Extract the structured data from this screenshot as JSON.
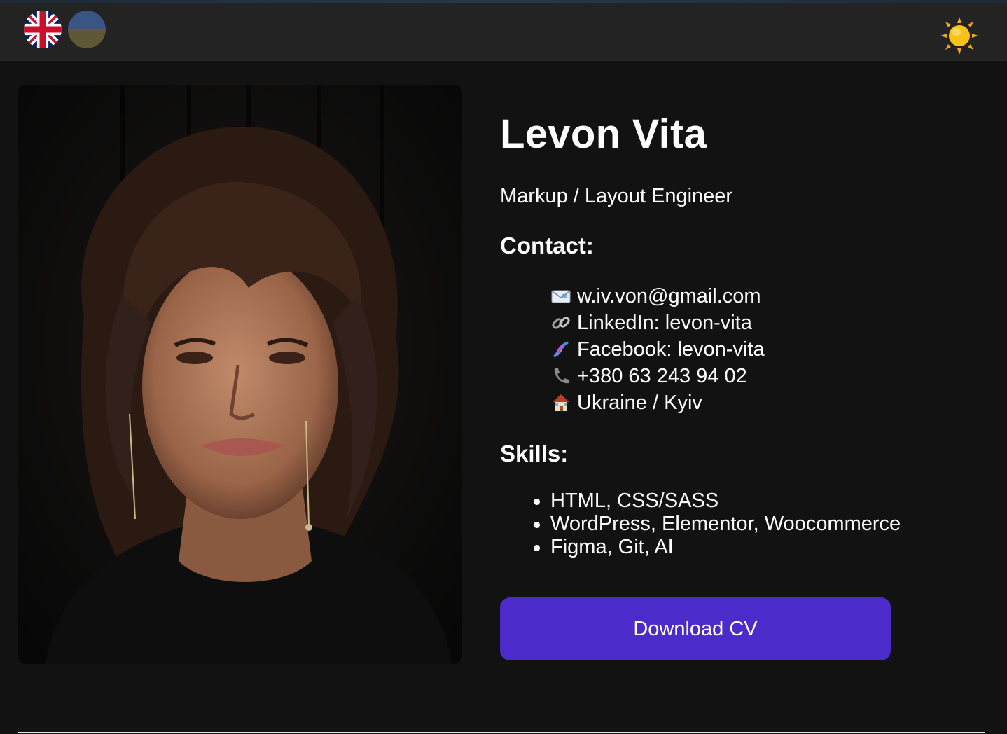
{
  "header": {
    "languages": [
      {
        "name": "English",
        "icon": "uk-flag-icon"
      },
      {
        "name": "Ukrainian",
        "icon": "ukraine-flag-icon"
      }
    ],
    "theme_icon": "sun-icon"
  },
  "profile": {
    "name": "Levon Vita",
    "role": "Markup / Layout Engineer",
    "photo_icon": "profile-photo"
  },
  "contact": {
    "heading": "Contact:",
    "items": [
      {
        "icon": "envelope-icon",
        "text": "w.iv.von@gmail.com"
      },
      {
        "icon": "link-icon",
        "text": "LinkedIn: levon-vita"
      },
      {
        "icon": "dna-icon",
        "text": "Facebook: levon-vita"
      },
      {
        "icon": "phone-icon",
        "text": "+380 63 243 94 02"
      },
      {
        "icon": "house-icon",
        "text": "Ukraine / Kyiv"
      }
    ]
  },
  "skills": {
    "heading": "Skills:",
    "items": [
      "HTML, CSS/SASS",
      "WordPress, Elementor, Woocommerce",
      "Figma, Git, AI"
    ]
  },
  "actions": {
    "download_label": "Download CV"
  },
  "colors": {
    "background": "#121212",
    "header": "#232323",
    "accent": "#4b2ccb",
    "text": "#ffffff"
  }
}
